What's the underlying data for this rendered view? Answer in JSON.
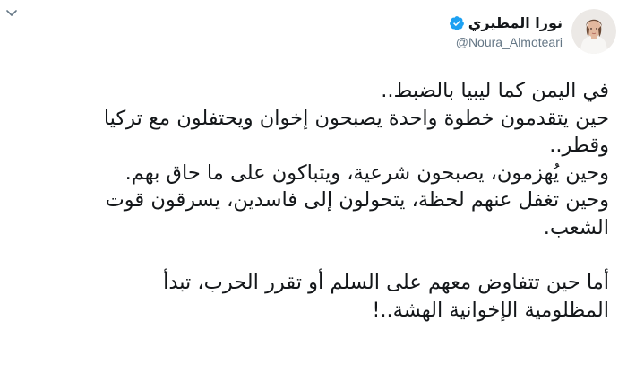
{
  "tweet": {
    "author": {
      "display_name": "نورا المطيري",
      "handle": "@Noura_Almoteari",
      "verified": true,
      "avatar_icon": "avatar-photo"
    },
    "menu_icon": "chevron-down-icon",
    "text_lines": [
      "في اليمن كما ليبيا بالضبط..",
      "حين يتقدمون خطوة واحدة يصبحون إخوان ويحتفلون مع تركيا",
      "وقطر..",
      "وحين يُهزمون، يصبحون شرعية، ويتباكون على ما حاق بهم.",
      "وحين تغفل عنهم لحظة، يتحولون إلى فاسدين، يسرقون قوت",
      "الشعب.",
      "",
      "أما حين تتفاوض معهم على السلم أو تقرر الحرب، تبدأ",
      "المظلومية الإخوانية الهشة..!"
    ]
  },
  "colors": {
    "text": "#14171a",
    "handle": "#657786",
    "verified_badge": "#1da1f2",
    "chevron": "#657786"
  }
}
